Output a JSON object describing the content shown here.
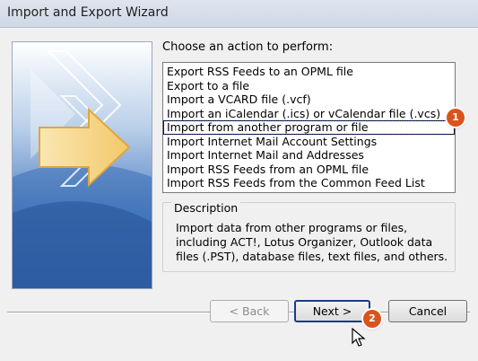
{
  "window": {
    "title": "Import and Export Wizard"
  },
  "prompt": "Choose an action to perform:",
  "actions": [
    "Export RSS Feeds to an OPML file",
    "Export to a file",
    "Import a VCARD file (.vcf)",
    "Import an iCalendar (.ics) or vCalendar file (.vcs)",
    "Import from another program or file",
    "Import Internet Mail Account Settings",
    "Import Internet Mail and Addresses",
    "Import RSS Feeds from an OPML file",
    "Import RSS Feeds from the Common Feed List"
  ],
  "selected_action": "Import from another program or file",
  "description": {
    "label": "Description",
    "text": "Import data from other programs or files, including ACT!, Lotus Organizer, Outlook data files (.PST), database files, text files, and others."
  },
  "buttons": {
    "back": "< Back",
    "next": "Next >",
    "cancel": "Cancel"
  },
  "badges": [
    "1",
    "2"
  ],
  "colors": {
    "badge": "#d9531e",
    "panel_blue": "#3b6db5",
    "selection_border": "#0b2a8a"
  },
  "icons": [
    "wizard-arrows-graphic",
    "mouse-cursor-icon"
  ]
}
